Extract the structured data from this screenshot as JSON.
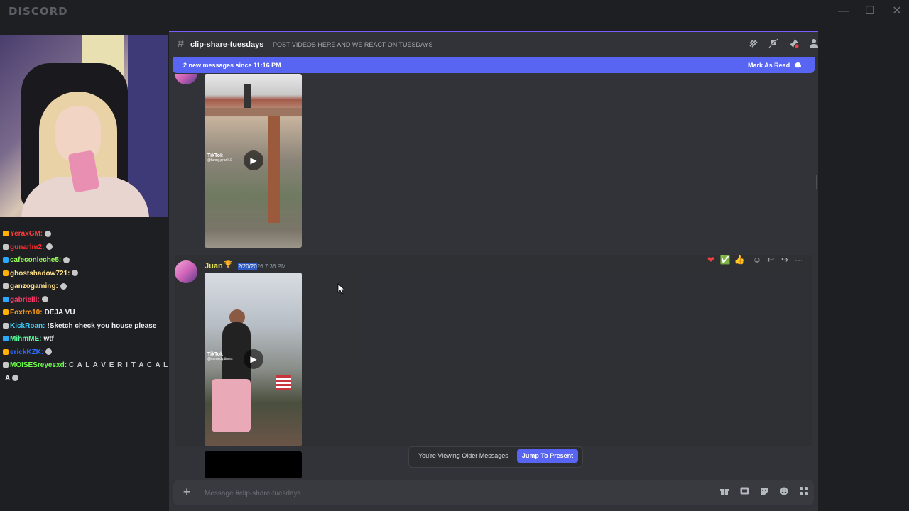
{
  "window": {
    "app_name": "DISCORD",
    "minimize": "—",
    "maximize": "☐",
    "close": "✕"
  },
  "stream_chat": {
    "lines": [
      {
        "user": "YeraxGM:",
        "user_color": "#ff3a3a",
        "text": "",
        "emote": true
      },
      {
        "user": "gunarlm2:",
        "user_color": "#ff2d2d",
        "text": "",
        "emote": true
      },
      {
        "user": "cafeconleche5:",
        "user_color": "#9aff5a",
        "text": "",
        "emote": true
      },
      {
        "user": "ghostshadow721:",
        "user_color": "#ffe08a",
        "text": "",
        "emote": true
      },
      {
        "user": "ganzogaming:",
        "user_color": "#ffe08a",
        "text": "",
        "emote": true
      },
      {
        "user": "gabrielll:",
        "user_color": "#ff3a6a",
        "text": "",
        "emote": true
      },
      {
        "user": "Foxtro10:",
        "user_color": "#ff9f1a",
        "text": "DEJA VU",
        "emote": false
      },
      {
        "user": "KickRoan:",
        "user_color": "#3ad1ff",
        "text": "!Sketch check you house please",
        "emote": false
      },
      {
        "user": "MihmME:",
        "user_color": "#5aff9c",
        "text": "wtf",
        "emote": false
      },
      {
        "user": "erickKZK:",
        "user_color": "#2a6cff",
        "text": "",
        "emote": true
      },
      {
        "user": "MOISESreyesxd:",
        "user_color": "#6cff4a",
        "text": "C A L A V E R I T A  C A L A V E R I T",
        "emote": true
      },
      {
        "user": "",
        "user_color": "#efeff1",
        "text": "A",
        "emote": true
      }
    ]
  },
  "channel": {
    "hash": "#",
    "name": "clip-share-tuesdays",
    "topic": "POST VIDEOS HERE AND WE REACT ON TUESDAYS"
  },
  "new_messages_bar": {
    "text": "2 new messages since 11:16 PM",
    "action": "Mark As Read"
  },
  "messages": [
    {
      "video": {
        "watermark": "TikTok",
        "handle": "@funny.prank.9",
        "play": "▶"
      }
    },
    {
      "author": "Juan",
      "author_badge": "🏆",
      "timestamp_highlight": "2/20/20",
      "timestamp_rest": "26 7:36 PM",
      "video": {
        "watermark": "TikTok",
        "handle": "@comedy.times",
        "play": "▶"
      }
    }
  ],
  "reactions": [
    "❤",
    "✅",
    "👍"
  ],
  "message_actions": [
    "☺",
    "↩",
    "↪",
    "···"
  ],
  "older_banner": {
    "text": "You're Viewing Older Messages",
    "button": "Jump To Present"
  },
  "composer": {
    "plus": "+",
    "placeholder": "Message #clip-share-tuesdays"
  },
  "colors": {
    "accent": "#5865f2",
    "panel": "#313338",
    "author": "#e9e357"
  }
}
